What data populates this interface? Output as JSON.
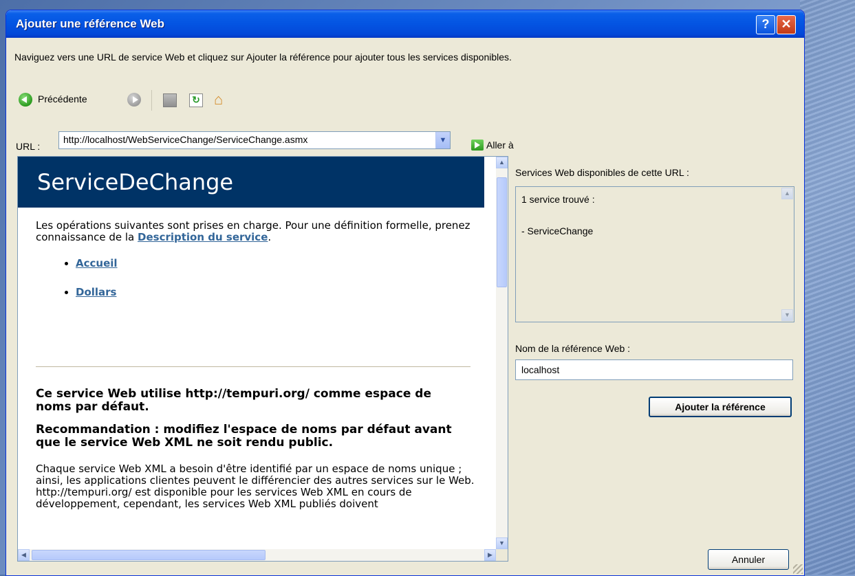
{
  "window": {
    "title": "Ajouter une référence Web",
    "help_glyph": "?",
    "close_glyph": "✕"
  },
  "instructions": "Naviguez vers une URL de service Web et cliquez sur Ajouter la référence pour ajouter tous les services disponibles.",
  "toolbar": {
    "back_label": "Précédente"
  },
  "url": {
    "label": "URL :",
    "value": "http://localhost/WebServiceChange/ServiceChange.asmx",
    "go_label": "Aller à"
  },
  "browser": {
    "page_title": "ServiceDeChange",
    "intro_text": "Les opérations suivantes sont prises en charge. Pour une définition formelle, prenez connaissance de la ",
    "description_link": "Description du service",
    "intro_end": ".",
    "operations": [
      "Accueil",
      "Dollars"
    ],
    "ns_heading": "Ce service Web utilise http://tempuri.org/ comme espace de noms par défaut.",
    "reco_heading": "Recommandation : modifiez l'espace de noms par défaut avant que le service Web XML ne soit rendu public.",
    "body_text": "Chaque service Web XML a besoin d'être identifié par un espace de noms unique ; ainsi, les applications clientes peuvent le différencier des autres services sur le Web. http://tempuri.org/ est disponible pour les services Web XML en cours de développement, cependant, les services Web XML publiés doivent"
  },
  "services": {
    "label": "Services Web disponibles de cette URL :",
    "count_text": "1 service trouvé :",
    "items": [
      "- ServiceChange"
    ]
  },
  "reference": {
    "name_label": "Nom de la référence Web :",
    "name_value": "localhost",
    "add_button": "Ajouter la référence"
  },
  "cancel_button": "Annuler"
}
